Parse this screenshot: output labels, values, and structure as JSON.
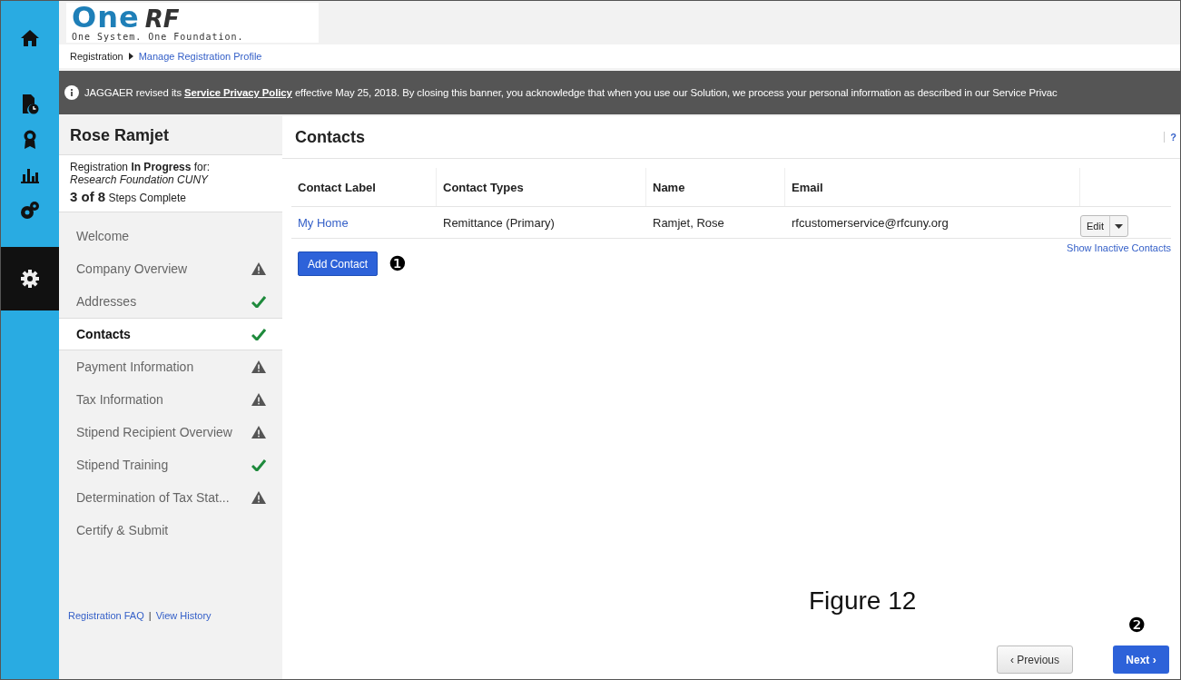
{
  "rail": {
    "items": [
      {
        "kind": "home",
        "selected": false
      },
      {
        "kind": "document",
        "selected": false
      },
      {
        "kind": "award",
        "selected": false
      },
      {
        "kind": "chart",
        "selected": false
      },
      {
        "kind": "gears",
        "selected": false
      },
      {
        "kind": "settings",
        "selected": true
      }
    ]
  },
  "logo": {
    "word": "One",
    "suffix": "RF",
    "tagline": "One System. One Foundation."
  },
  "breadcrumb": [
    "Registration",
    "Manage Registration Profile"
  ],
  "banner": {
    "before": "JAGGAER revised its ",
    "link": "Service Privacy Policy",
    "after": " effective May 25, 2018. By closing this banner, you acknowledge that when you use our Solution, we process your personal information as described in our Service Privac"
  },
  "sidebar": {
    "name": "Rose Ramjet",
    "status": "Registration **In Progress** for:",
    "organization": "Research Foundation CUNY",
    "progress_count": "3 of 8",
    "progress_label": "Steps Complete",
    "steps": [
      {
        "label": "Welcome",
        "kind": "none",
        "selected": false
      },
      {
        "label": "Company Overview",
        "kind": "warning",
        "selected": false
      },
      {
        "label": "Addresses",
        "kind": "done",
        "selected": false
      },
      {
        "label": "Contacts",
        "kind": "done",
        "selected": true
      },
      {
        "label": "Payment Information",
        "kind": "warning",
        "selected": false
      },
      {
        "label": "Tax Information",
        "kind": "warning",
        "selected": false
      },
      {
        "label": "Stipend Recipient Overview",
        "kind": "warning",
        "selected": false
      },
      {
        "label": "Stipend Training",
        "kind": "done",
        "selected": false
      },
      {
        "label": "Determination of Tax Stat...",
        "kind": "warning",
        "selected": false
      },
      {
        "label": "Certify & Submit",
        "kind": "none",
        "selected": false
      }
    ],
    "links": [
      "Registration FAQ",
      "View History"
    ],
    "separator": "|"
  },
  "content": {
    "title": "Contacts",
    "help": "?",
    "table": {
      "columns": [
        "Contact Label",
        "Contact Types",
        "Name",
        "Email"
      ],
      "rows": [
        {
          "label": "My Home",
          "types": "Remittance (Primary)",
          "name": "Ramjet, Rose",
          "email": "rfcustomerservice@rfcuny.org",
          "action": "Edit"
        }
      ]
    },
    "add_button": "Add Contact",
    "callout_1": "❶",
    "inactive_link": "Show Inactive Contacts",
    "figure_caption": "Figure 12",
    "callout_2": "❷",
    "previous_button": "‹ Previous",
    "next_button": "Next ›"
  }
}
